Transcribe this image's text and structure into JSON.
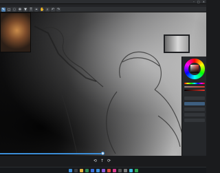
{
  "app": {
    "title": "",
    "window_controls": [
      "–",
      "□",
      "✕"
    ]
  },
  "menubar": {
    "items": [
      "",
      "",
      "",
      "",
      "",
      "",
      "",
      "",
      ""
    ]
  },
  "toolbar": {
    "tools": [
      {
        "icon": "brush-icon",
        "glyph": "✎",
        "active": true
      },
      {
        "icon": "eraser-icon",
        "glyph": "◻",
        "active": false
      },
      {
        "icon": "lasso-icon",
        "glyph": "◌",
        "active": false
      },
      {
        "icon": "move-icon",
        "glyph": "✥",
        "active": false
      },
      {
        "icon": "fill-icon",
        "glyph": "▼",
        "active": false
      },
      {
        "icon": "text-icon",
        "glyph": "T",
        "active": false
      },
      {
        "icon": "eyedropper-icon",
        "glyph": "⌖",
        "active": false
      },
      {
        "icon": "hand-icon",
        "glyph": "✋",
        "active": false
      },
      {
        "icon": "zoom-icon",
        "glyph": "⌕",
        "active": false
      },
      {
        "icon": "undo-icon",
        "glyph": "↶",
        "active": false
      },
      {
        "icon": "redo-icon",
        "glyph": "↷",
        "active": false
      }
    ]
  },
  "color_panel": {
    "current_color": "#e0352b",
    "sliders": [
      {
        "name": "hue-slider",
        "gradient": "linear-gradient(90deg,#f00,#ff0,#0f0,#0ff,#00f,#f0f,#f00)"
      },
      {
        "name": "saturation-slider",
        "gradient": "linear-gradient(90deg,#888,#e0352b)"
      },
      {
        "name": "value-slider",
        "gradient": "linear-gradient(90deg,#000,#e0352b)"
      }
    ]
  },
  "layers": {
    "rows": [
      {
        "active": false
      },
      {
        "active": true
      },
      {
        "active": false
      },
      {
        "active": false
      },
      {
        "active": false
      }
    ]
  },
  "timeline": {
    "progress": 0.5
  },
  "playback": {
    "prev": "⟲",
    "play": "↑",
    "next": "⟳"
  },
  "taskbar": {
    "icons": [
      {
        "icon": "start-icon",
        "color": "#3c8ed8"
      },
      {
        "icon": "search-icon",
        "color": "#3a3d41"
      },
      {
        "icon": "files-icon",
        "color": "#e0b040"
      },
      {
        "icon": "browser-icon",
        "color": "#2e8b57"
      },
      {
        "icon": "store-icon",
        "color": "#3c6ed8"
      },
      {
        "icon": "mail-icon",
        "color": "#3c8ed8"
      },
      {
        "icon": "chat-icon",
        "color": "#8a5cd8"
      },
      {
        "icon": "paint-app-icon",
        "color": "#d84a3c"
      },
      {
        "icon": "music-icon",
        "color": "#d83c8e"
      },
      {
        "icon": "terminal-icon",
        "color": "#555"
      },
      {
        "icon": "settings-icon",
        "color": "#777"
      },
      {
        "icon": "photos-icon",
        "color": "#3cb8d8"
      },
      {
        "icon": "game-icon",
        "color": "#2ea44f"
      }
    ],
    "clock": ""
  },
  "colors": {
    "accent": "#3c8ed8",
    "panel_bg": "#25272a",
    "toolbar_bg": "#2e3033"
  }
}
